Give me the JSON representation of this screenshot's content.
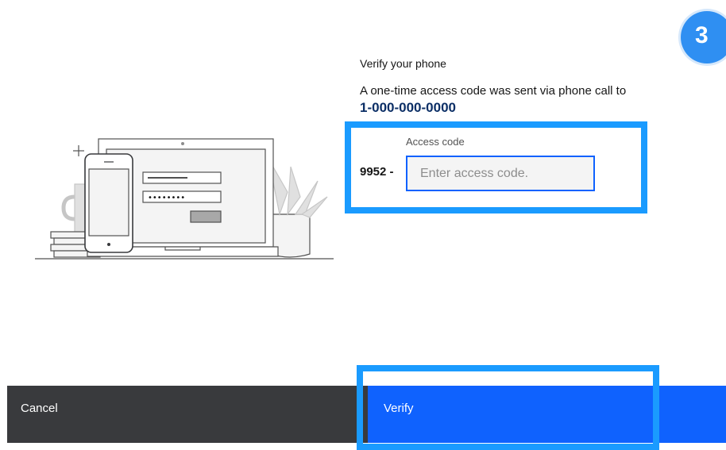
{
  "step_badge": "3",
  "title": "Verify your phone",
  "description": "A one-time access code was sent via phone call to",
  "phone_number": "1-000-000-0000",
  "access_code": {
    "label": "Access code",
    "prefix": "9952 -",
    "value": "",
    "placeholder": "Enter access code."
  },
  "illustration": {
    "password_mask": "••••••••"
  },
  "buttons": {
    "cancel": "Cancel",
    "verify": "Verify"
  },
  "colors": {
    "primary": "#0f62fe",
    "secondary": "#393a3d",
    "highlight": "#1a9bff",
    "phone_text": "#0c2f66",
    "badge": "#2f8ff2"
  }
}
